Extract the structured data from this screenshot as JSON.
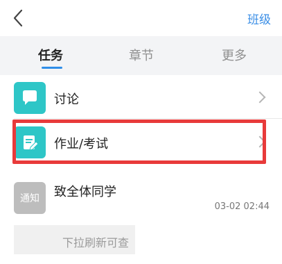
{
  "header": {
    "title": "",
    "right_label": "班级"
  },
  "tabs": [
    {
      "label": "任务",
      "active": true
    },
    {
      "label": "章节",
      "active": false
    },
    {
      "label": "更多",
      "active": false
    }
  ],
  "items": [
    {
      "label": "讨论",
      "icon": "discussion-icon"
    },
    {
      "label": "作业/考试",
      "icon": "homework-icon"
    }
  ],
  "notice": {
    "badge": "通知",
    "title": "致全体同学",
    "time": "03-02 02:44"
  },
  "refresh_hint": "下拉刷新可查",
  "colors": {
    "accent": "#3a8ee6",
    "teal": "#2ec6c7",
    "highlight": "#e83a3a"
  }
}
